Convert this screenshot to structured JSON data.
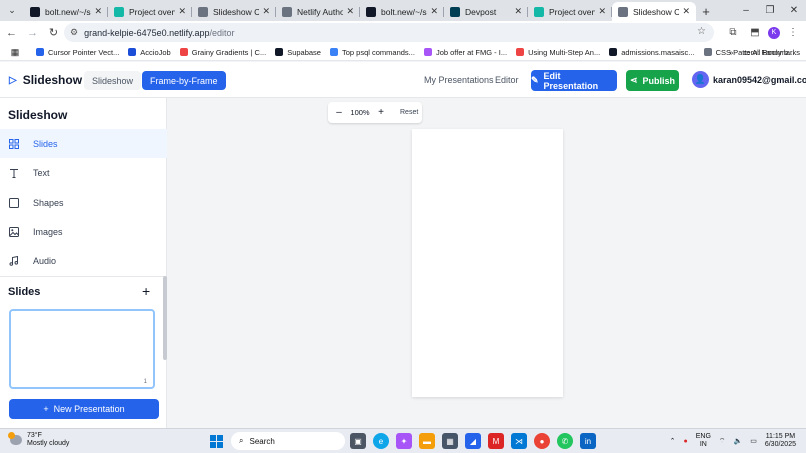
{
  "browser": {
    "tabs": [
      {
        "title": "bolt.new/~/sb1",
        "favicon": "bolt-icon",
        "color": "#111827",
        "active": false
      },
      {
        "title": "Project overview",
        "favicon": "netlify-icon",
        "color": "#14b8a6",
        "active": false
      },
      {
        "title": "Slideshow Creat",
        "favicon": "globe-icon",
        "color": "#6b7280",
        "active": false
      },
      {
        "title": "Netlify Authoriz",
        "favicon": "globe-icon",
        "color": "#6b7280",
        "active": false
      },
      {
        "title": "bolt.new/~/sb1",
        "favicon": "bolt-icon",
        "color": "#111827",
        "active": false
      },
      {
        "title": "Devpost",
        "favicon": "devpost-icon",
        "color": "#003e54",
        "active": false
      },
      {
        "title": "Project overview",
        "favicon": "netlify-icon",
        "color": "#14b8a6",
        "active": false
      },
      {
        "title": "Slideshow Creat",
        "favicon": "globe-icon",
        "color": "#6b7280",
        "active": true
      }
    ],
    "url_host": "grand-kelpie-6475e0.netlify.app",
    "url_path": "/editor",
    "bookmarks": [
      {
        "label": "Cursor Pointer Vect...",
        "color": "#2563eb"
      },
      {
        "label": "AccioJob",
        "color": "#1d4ed8"
      },
      {
        "label": "Grainy Gradients | C...",
        "color": "#ef4444"
      },
      {
        "label": "Supabase",
        "color": "#111827"
      },
      {
        "label": "Top psql commands...",
        "color": "#3b82f6"
      },
      {
        "label": "Job offer at FMG - I...",
        "color": "#a855f7"
      },
      {
        "label": "Using Multi-Step An...",
        "color": "#ef4444"
      },
      {
        "label": "admissions.masaisc...",
        "color": "#111827"
      },
      {
        "label": "CSS Pattern: Fancy b...",
        "color": "#6b7280"
      }
    ],
    "all_bookmarks_label": "All Bookmarks",
    "profile_initial": "K"
  },
  "header": {
    "logo": "Slideshow",
    "modes": [
      "Slideshow",
      "Frame-by-Frame"
    ],
    "active_mode": "Frame-by-Frame",
    "my_presentations": "My Presentations",
    "editor": "Editor",
    "edit_button": "Edit Presentation",
    "publish_button": "Publish",
    "user_email": "karan09542@gmail.com"
  },
  "sidebar": {
    "title": "Slideshow",
    "items": [
      {
        "label": "Slides",
        "icon": "grid-icon",
        "active": true
      },
      {
        "label": "Text",
        "icon": "text-icon",
        "active": false
      },
      {
        "label": "Shapes",
        "icon": "square-icon",
        "active": false
      },
      {
        "label": "Images",
        "icon": "image-icon",
        "active": false
      },
      {
        "label": "Audio",
        "icon": "music-icon",
        "active": false
      }
    ],
    "slides_heading": "Slides",
    "slide_thumbs": [
      {
        "number": "1"
      }
    ],
    "new_presentation": "New Presentation"
  },
  "canvas": {
    "zoom": "100%",
    "reset": "Reset"
  },
  "taskbar": {
    "temperature": "73°F",
    "weather": "Mostly cloudy",
    "search_placeholder": "Search",
    "lang1": "ENG",
    "lang2": "IN",
    "time": "11:15 PM",
    "date": "6/30/2025"
  },
  "colors": {
    "primary": "#2563eb",
    "publish": "#16a34a"
  }
}
